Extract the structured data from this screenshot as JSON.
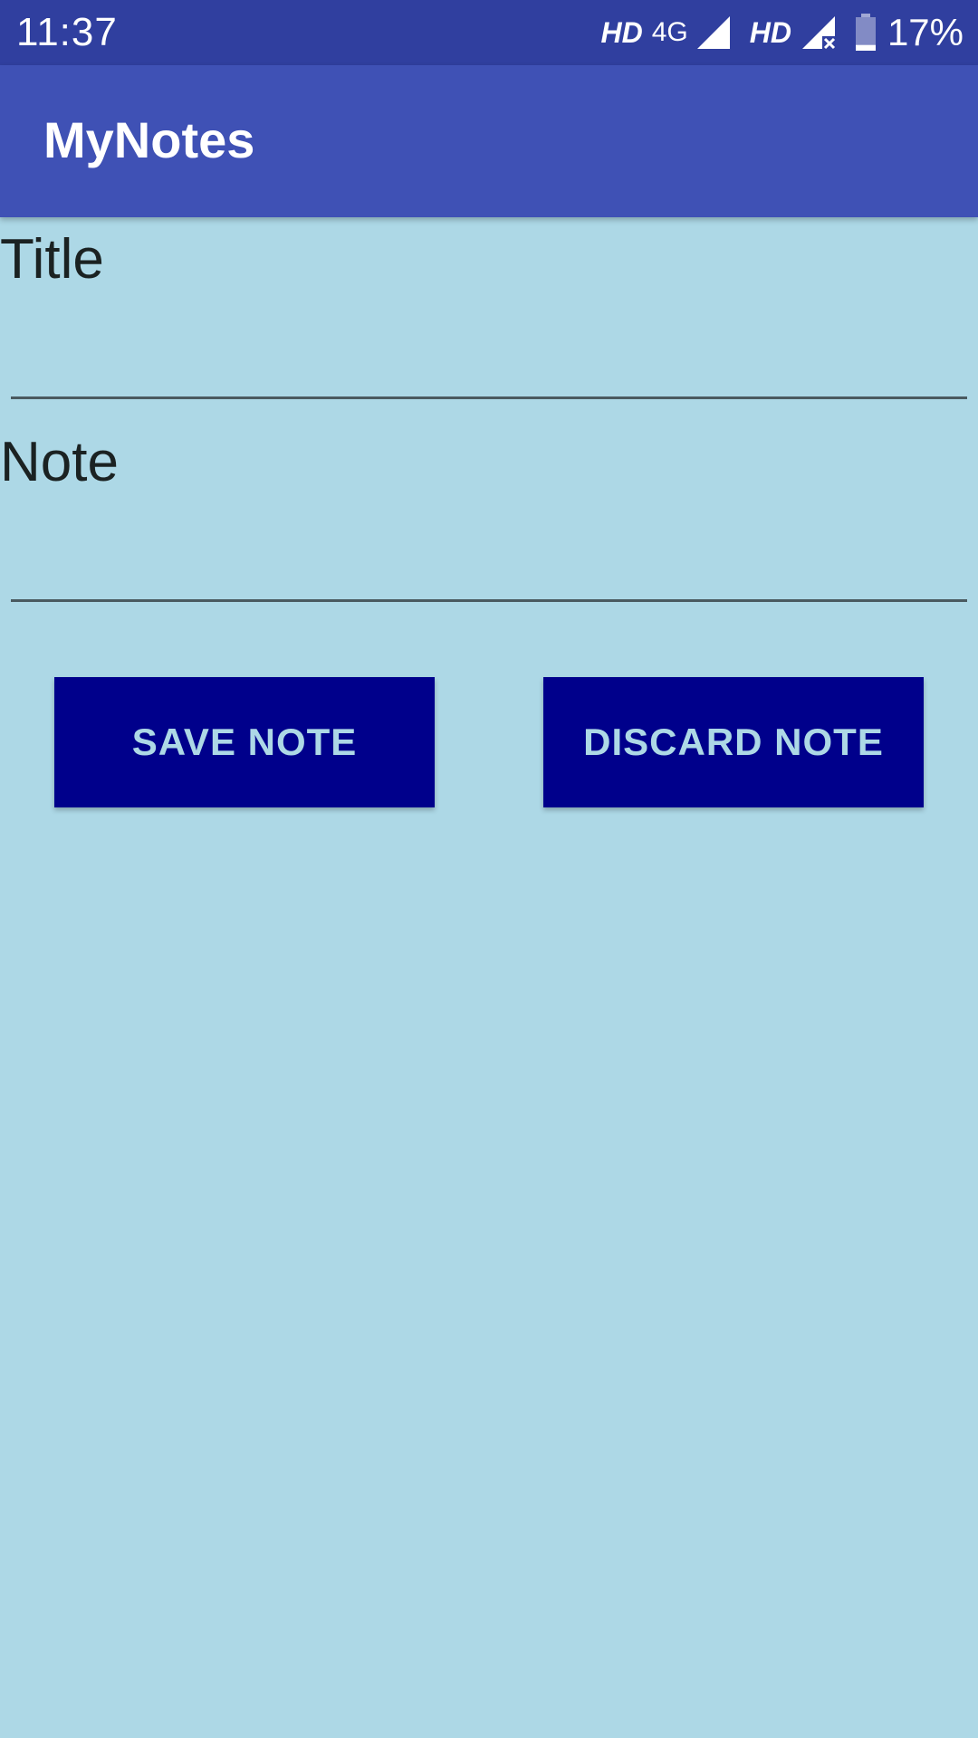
{
  "status_bar": {
    "time": "11:37",
    "hd_label_1": "HD",
    "network_label": "4G",
    "hd_label_2": "HD",
    "battery_percent": "17%",
    "battery_level": 0.17,
    "icons": [
      "signal-icon",
      "signal-no-data-icon",
      "battery-icon"
    ]
  },
  "app_bar": {
    "title": "MyNotes"
  },
  "form": {
    "title_label": "Title",
    "title_value": "",
    "note_label": "Note",
    "note_value": ""
  },
  "actions": {
    "save_label": "SAVE NOTE",
    "discard_label": "DISCARD NOTE"
  },
  "colors": {
    "status_bar": "#303f9f",
    "app_bar": "#3f51b5",
    "background": "#add8e6",
    "button_bg": "#00008b",
    "button_text": "#add8e6"
  }
}
